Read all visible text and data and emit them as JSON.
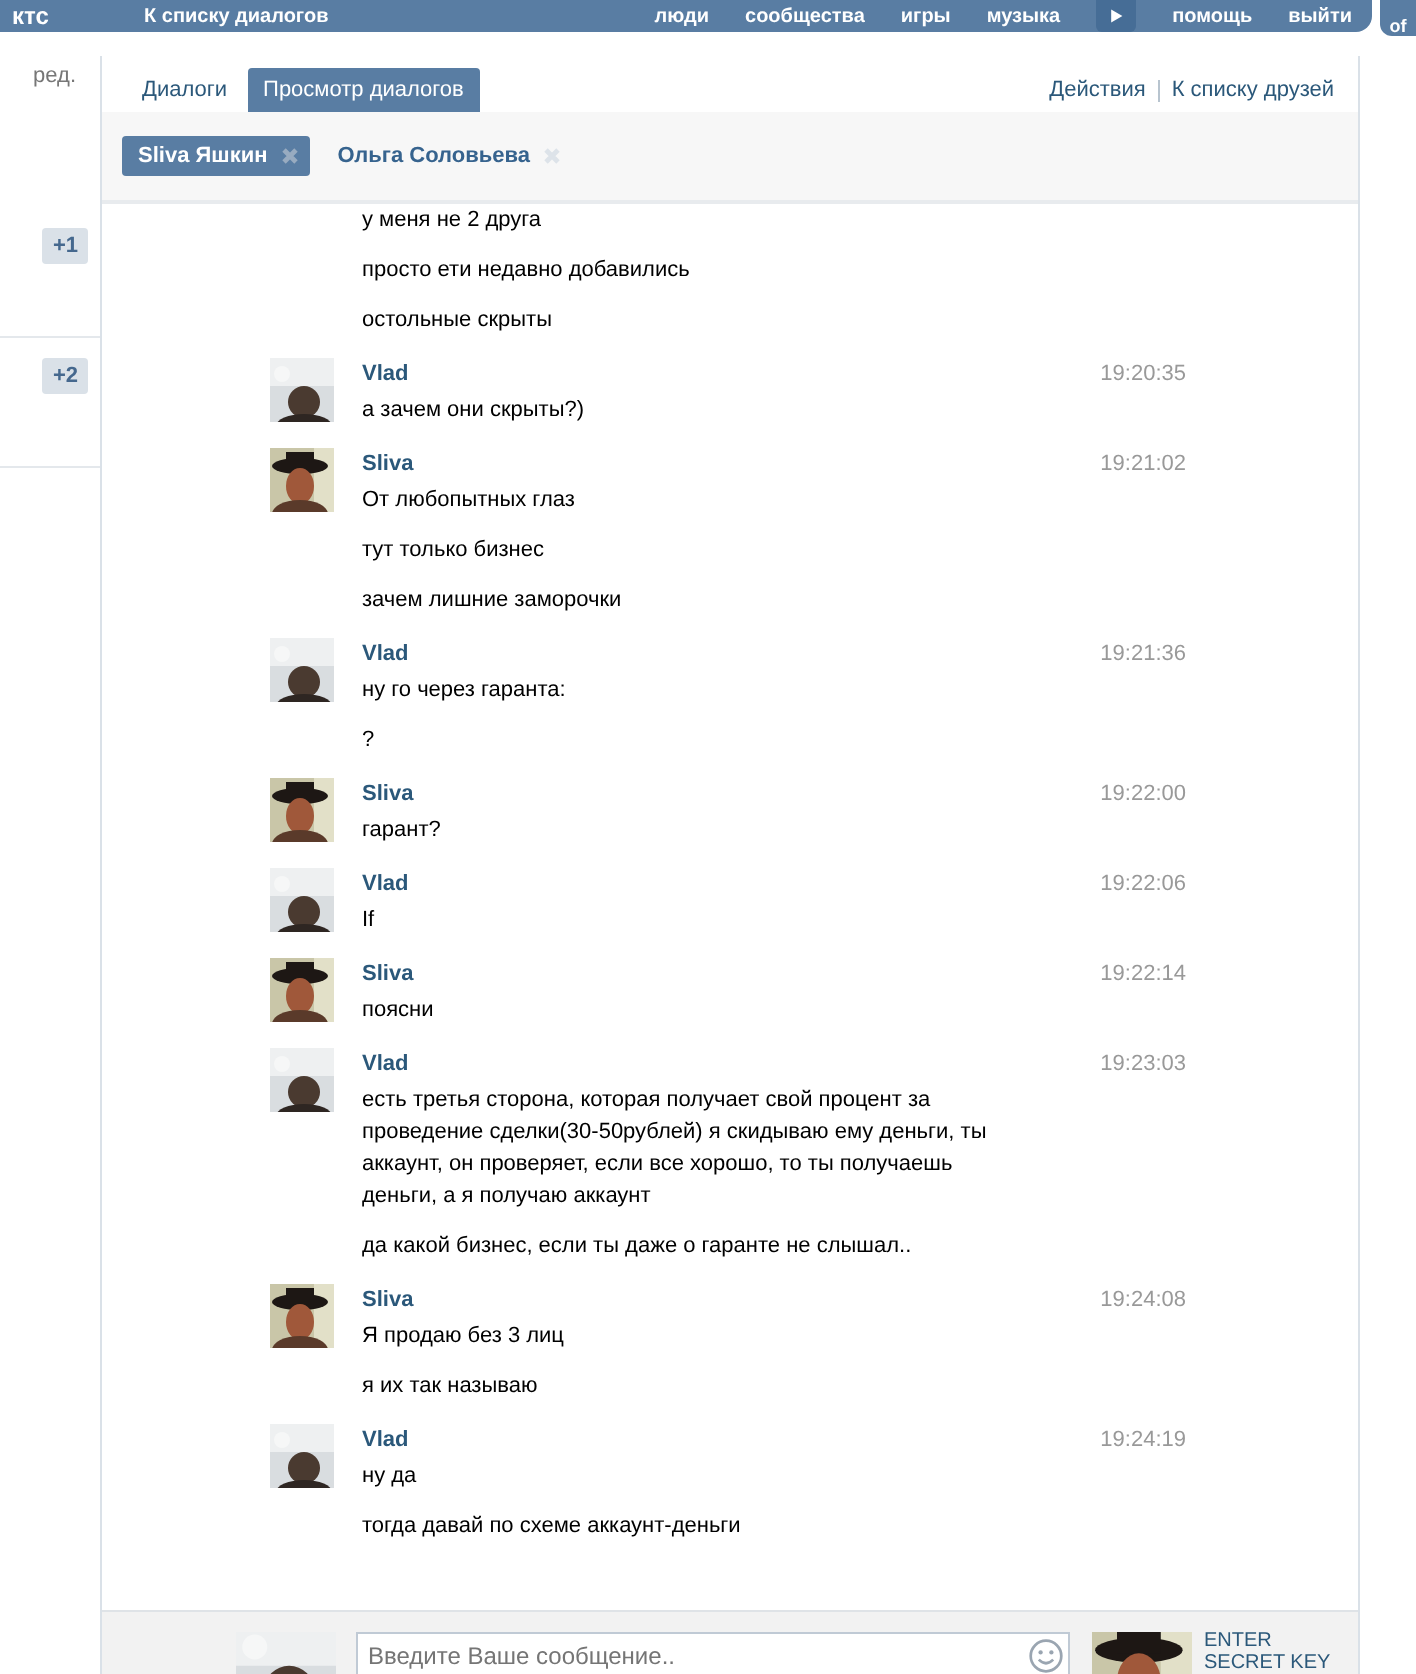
{
  "header": {
    "logo": "ктс",
    "back": "К списку диалогов",
    "nav": [
      "люди",
      "сообщества",
      "игры",
      "музыка",
      "помощь",
      "выйти"
    ],
    "corner": "of"
  },
  "sidebar": {
    "edit": "ред.",
    "badges": [
      "+1",
      "+2"
    ]
  },
  "tabs": [
    {
      "label": "Диалоги",
      "selected": false
    },
    {
      "label": "Просмотр диалогов",
      "selected": true
    }
  ],
  "actions": [
    "Действия",
    "К списку друзей"
  ],
  "chats": [
    {
      "name": "Sliva Яшкин",
      "selected": true
    },
    {
      "name": "Ольга Соловьева",
      "selected": false
    }
  ],
  "messages": [
    {
      "lines": [
        "у меня не 2 друга",
        "просто ети недавно добавились",
        "остольные скрыты"
      ]
    },
    {
      "author": "Vlad",
      "avatar_hat": false,
      "time": "19:20:35",
      "lines": [
        "а зачем они скрыты?)"
      ]
    },
    {
      "author": "Sliva",
      "avatar_hat": true,
      "time": "19:21:02",
      "lines": [
        "От любопытных глаз",
        "тут только бизнес",
        "зачем лишние заморочки"
      ]
    },
    {
      "author": "Vlad",
      "avatar_hat": false,
      "time": "19:21:36",
      "lines": [
        "ну го через гаранта:",
        "?"
      ]
    },
    {
      "author": "Sliva",
      "avatar_hat": true,
      "time": "19:22:00",
      "lines": [
        "гарант?"
      ]
    },
    {
      "author": "Vlad",
      "avatar_hat": false,
      "time": "19:22:06",
      "lines": [
        "If"
      ]
    },
    {
      "author": "Sliva",
      "avatar_hat": true,
      "time": "19:22:14",
      "lines": [
        "поясни"
      ]
    },
    {
      "author": "Vlad",
      "avatar_hat": false,
      "time": "19:23:03",
      "lines": [
        "есть третья сторона, которая получает свой процент за проведение сделки(30-50рублей) я скидываю ему деньги, ты аккаунт, он проверяет, если все хорошо, то ты получаешь деньги, а я получаю аккаунт",
        "да какой бизнес, если ты даже о гаранте не слышал.."
      ]
    },
    {
      "author": "Sliva",
      "avatar_hat": true,
      "time": "19:24:08",
      "lines": [
        "Я продаю без 3 лиц",
        "я их так называю"
      ]
    },
    {
      "author": "Vlad",
      "avatar_hat": false,
      "time": "19:24:19",
      "lines": [
        "ну да",
        "тогда давай по схеме аккаунт-деньги"
      ]
    }
  ],
  "composer": {
    "placeholder": "Введите Ваше сообщение..",
    "my_avatar_hat": false,
    "peer_avatar_hat": true,
    "secret_lines": [
      "ENTER",
      "SECRET KEY"
    ]
  }
}
